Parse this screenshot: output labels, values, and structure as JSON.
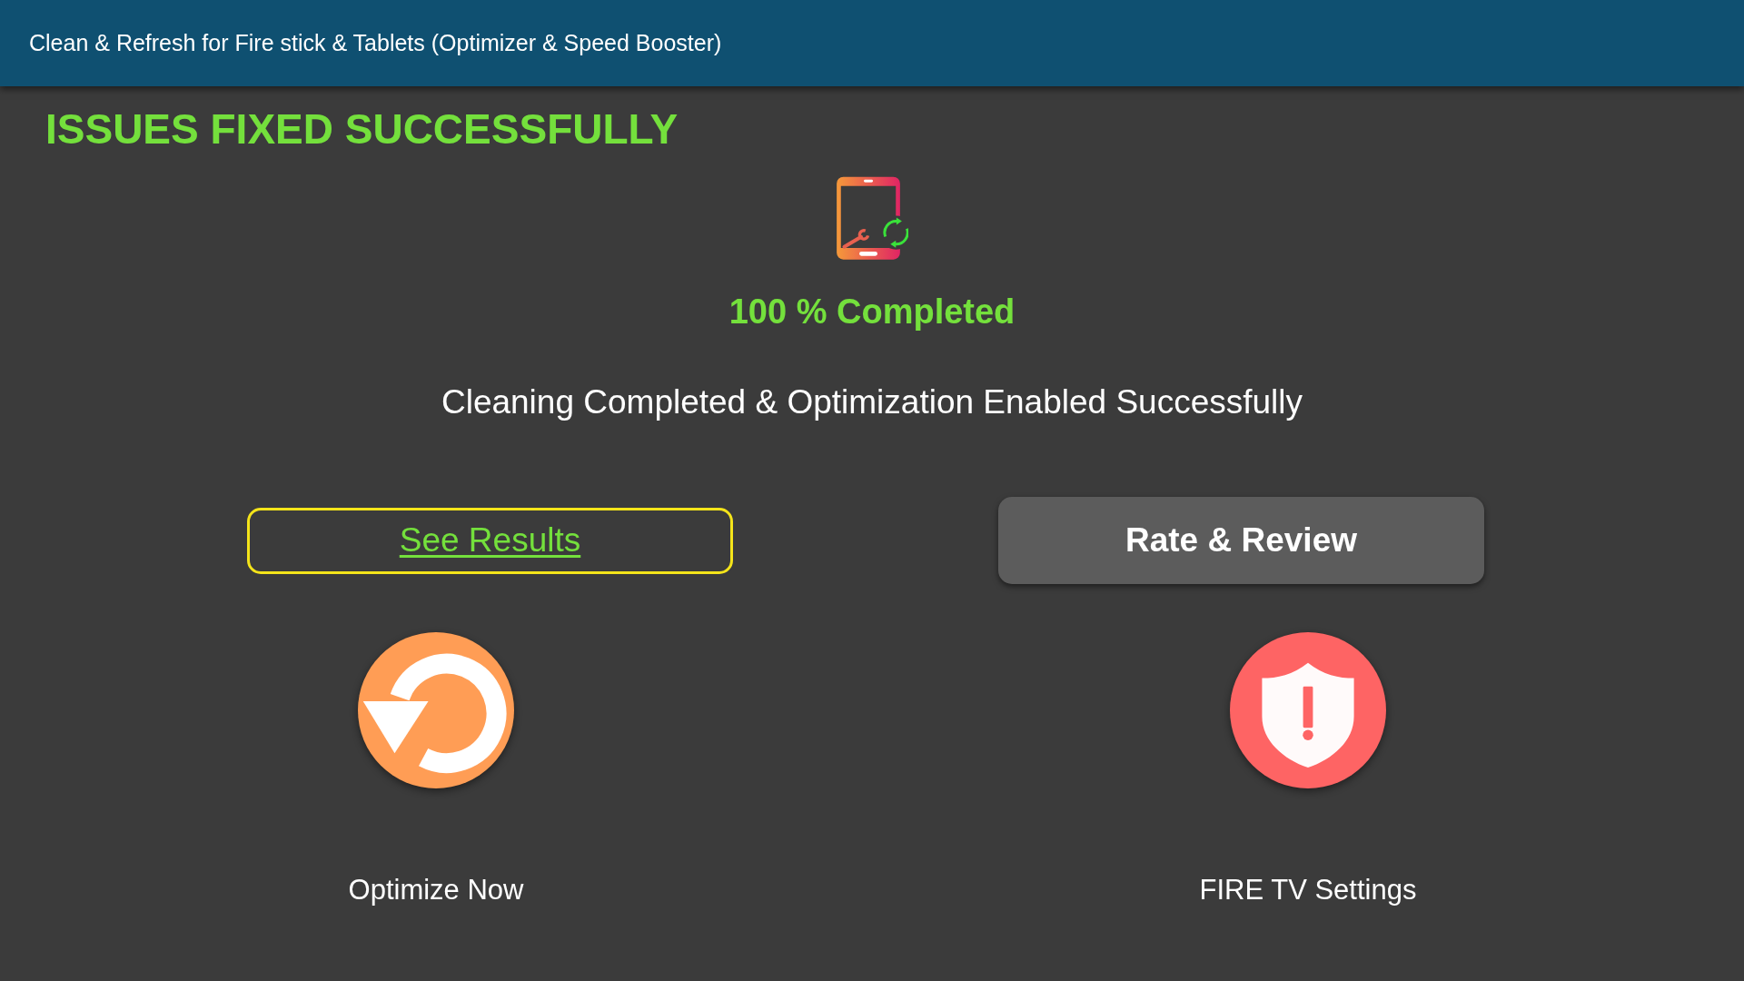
{
  "app_bar": {
    "title": "Clean & Refresh for Fire stick & Tablets (Optimizer & Speed Booster)"
  },
  "result": {
    "heading": "ISSUES FIXED SUCCESSFULLY",
    "progress": "100 % Completed",
    "message": "Cleaning Completed & Optimization Enabled Successfully"
  },
  "buttons": [
    {
      "label": "See Results",
      "kind": "link",
      "focused": true
    },
    {
      "label": "Rate & Review",
      "kind": "raised",
      "focused": false
    }
  ],
  "shortcuts": [
    {
      "label": "Optimize Now",
      "kind": "optimize"
    },
    {
      "label": "FIRE TV Settings",
      "kind": "security"
    }
  ]
}
